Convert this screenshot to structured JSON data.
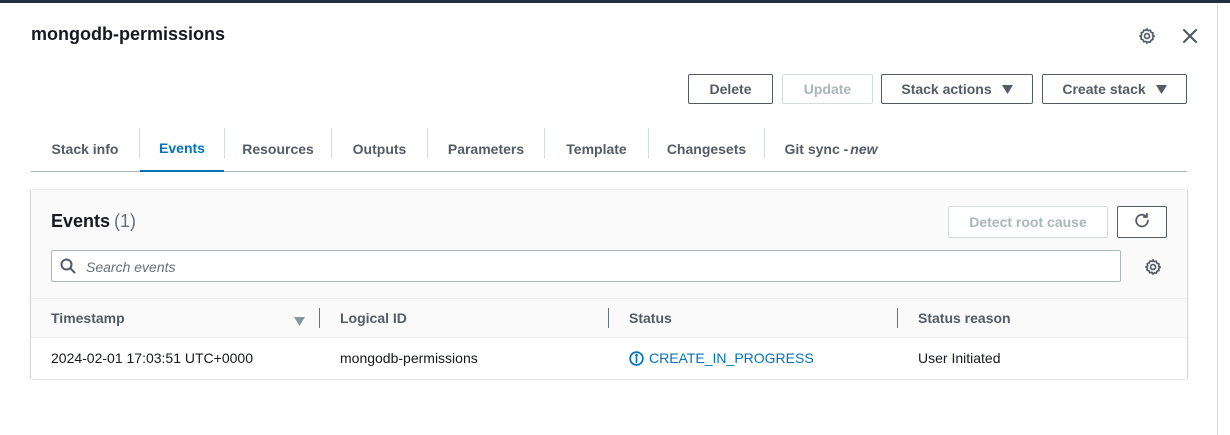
{
  "header": {
    "title": "mongodb-permissions"
  },
  "actions": {
    "delete": "Delete",
    "update": "Update",
    "stack_actions": "Stack actions",
    "create_stack": "Create stack"
  },
  "tabs": [
    {
      "label": "Stack info"
    },
    {
      "label": "Events"
    },
    {
      "label": "Resources"
    },
    {
      "label": "Outputs"
    },
    {
      "label": "Parameters"
    },
    {
      "label": "Template"
    },
    {
      "label": "Changesets"
    },
    {
      "label": "Git sync -",
      "badge": "new"
    }
  ],
  "events": {
    "title": "Events",
    "count": "(1)",
    "detect_root_cause": "Detect root cause",
    "search_placeholder": "Search events",
    "columns": [
      "Timestamp",
      "Logical ID",
      "Status",
      "Status reason"
    ],
    "rows": [
      {
        "timestamp": "2024-02-01 17:03:51 UTC+0000",
        "logical_id": "mongodb-permissions",
        "status": "CREATE_IN_PROGRESS",
        "status_reason": "User Initiated"
      }
    ]
  },
  "colors": {
    "accent": "#0073bb",
    "text": "#16191f",
    "muted": "#545b64",
    "disabled": "#aab7b8",
    "top_bar": "#232f3e"
  },
  "icons": {
    "settings": "gear-icon",
    "close": "close-icon",
    "refresh": "refresh-icon",
    "search": "search-icon",
    "sort": "sort-down-icon",
    "status_info": "info-icon"
  }
}
